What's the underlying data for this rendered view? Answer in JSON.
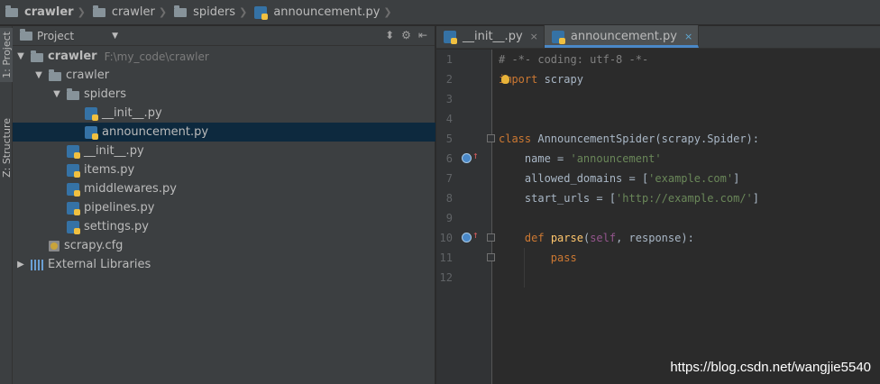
{
  "breadcrumb": [
    {
      "label": "crawler",
      "icon": "folder-icon",
      "bold": true
    },
    {
      "label": "crawler",
      "icon": "folder-icon",
      "bold": false
    },
    {
      "label": "spiders",
      "icon": "folder-icon",
      "bold": false
    },
    {
      "label": "announcement.py",
      "icon": "python-file-icon",
      "bold": false
    }
  ],
  "toolstrip": {
    "project_tab": "1: Project",
    "structure_tab": "Z: Structure"
  },
  "project_panel": {
    "title": "Project",
    "root": {
      "label": "crawler",
      "path": "F:\\my_code\\crawler"
    },
    "tree": [
      {
        "label": "crawler",
        "depth": 1,
        "type": "folder",
        "expanded": true
      },
      {
        "label": "spiders",
        "depth": 2,
        "type": "folder",
        "expanded": true
      },
      {
        "label": "__init__.py",
        "depth": 3,
        "type": "python"
      },
      {
        "label": "announcement.py",
        "depth": 3,
        "type": "python",
        "selected": true
      },
      {
        "label": "__init__.py",
        "depth": 2,
        "type": "python"
      },
      {
        "label": "items.py",
        "depth": 2,
        "type": "python"
      },
      {
        "label": "middlewares.py",
        "depth": 2,
        "type": "python"
      },
      {
        "label": "pipelines.py",
        "depth": 2,
        "type": "python"
      },
      {
        "label": "settings.py",
        "depth": 2,
        "type": "python"
      },
      {
        "label": "scrapy.cfg",
        "depth": 1,
        "type": "config"
      },
      {
        "label": "External Libraries",
        "depth": 0,
        "type": "library",
        "collapsed": true
      }
    ]
  },
  "editor": {
    "tabs": [
      {
        "label": "__init__.py",
        "active": false,
        "close": "×"
      },
      {
        "label": "announcement.py",
        "active": true,
        "close": "×"
      }
    ],
    "line_numbers": [
      "1",
      "2",
      "3",
      "4",
      "5",
      "6",
      "7",
      "8",
      "9",
      "10",
      "11",
      "12"
    ]
  },
  "watermark": "https://blog.csdn.net/wangjie5540",
  "colors": {
    "selection": "#0d293e",
    "keyword": "#cc7832",
    "string": "#6a8759",
    "function": "#ffc66d",
    "comment": "#808080",
    "active_tab_underline": "#4a88c7"
  }
}
